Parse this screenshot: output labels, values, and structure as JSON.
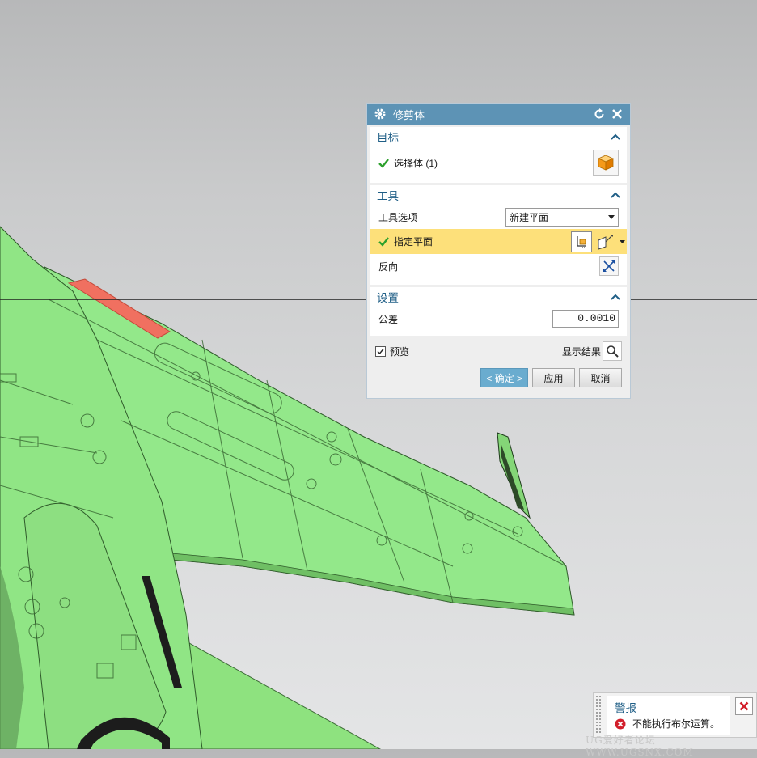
{
  "dialog": {
    "title": "修剪体",
    "groups": {
      "target": {
        "label": "目标",
        "select_body": "选择体 (1)"
      },
      "tool": {
        "label": "工具",
        "tool_option_label": "工具选项",
        "tool_option_value": "新建平面",
        "specify_plane": "指定平面",
        "reverse_label": "反向"
      },
      "settings": {
        "label": "设置",
        "tolerance_label": "公差",
        "tolerance_value": "0.0010"
      }
    },
    "preview_label": "预览",
    "preview_checked": true,
    "show_result_label": "显示结果",
    "buttons": {
      "ok": "< 确定 >",
      "apply": "应用",
      "cancel": "取消"
    }
  },
  "alert": {
    "title": "警报",
    "message": "不能执行布尔运算。"
  },
  "watermark": "UG爱好者论坛 WWW.UGSNX.COM",
  "colors": {
    "title_bar": "#5d93b5",
    "group_header": "#1f5e86",
    "highlight": "#fde07a",
    "model_green": "#93e88a",
    "selected_face": "#f07060",
    "ok_button": "#6aaccf"
  }
}
